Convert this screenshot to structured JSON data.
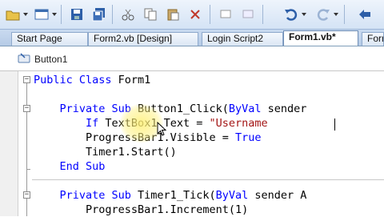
{
  "toolbar": {
    "icons": [
      "open-folder-icon",
      "layout-dropdown-icon",
      "save-icon",
      "save-all-icon",
      "cut-icon",
      "copy-icon",
      "paste-icon",
      "delete-icon",
      "undo-icon",
      "redo-icon",
      "navigate-icon"
    ]
  },
  "tabs": [
    {
      "label": "Start Page",
      "active": false
    },
    {
      "label": "Form2.vb [Design]",
      "active": false
    },
    {
      "label": "Login Script2",
      "active": false
    },
    {
      "label": "Form1.vb*",
      "active": true
    },
    {
      "label": "Form",
      "active": false
    }
  ],
  "object_combo": {
    "label": "Button1",
    "icon": "button-component-icon"
  },
  "code_lines": [
    {
      "tokens": [
        {
          "t": "Public Class ",
          "k": "kw"
        },
        {
          "t": "Form1",
          "k": ""
        }
      ]
    },
    {
      "tokens": []
    },
    {
      "tokens": [
        {
          "t": "    Private Sub ",
          "k": "kw"
        },
        {
          "t": "Button1_Click(",
          "k": ""
        },
        {
          "t": "ByVal",
          "k": "kw"
        },
        {
          "t": " sender",
          "k": ""
        }
      ]
    },
    {
      "tokens": [
        {
          "t": "        ",
          "k": ""
        },
        {
          "t": "If ",
          "k": "kw"
        },
        {
          "t": "TextBox1.Text = ",
          "k": ""
        },
        {
          "t": "\"Username",
          "k": "str"
        }
      ]
    },
    {
      "tokens": [
        {
          "t": "        ProgressBar1.Visible = ",
          "k": ""
        },
        {
          "t": "True",
          "k": "kw"
        }
      ]
    },
    {
      "tokens": [
        {
          "t": "        Timer1.Start()",
          "k": ""
        }
      ]
    },
    {
      "tokens": [
        {
          "t": "    End Sub",
          "k": "kw"
        }
      ]
    },
    {
      "tokens": []
    },
    {
      "tokens": [
        {
          "t": "    Private Sub ",
          "k": "kw"
        },
        {
          "t": "Timer1_Tick(",
          "k": ""
        },
        {
          "t": "ByVal",
          "k": "kw"
        },
        {
          "t": " sender A",
          "k": ""
        }
      ]
    },
    {
      "tokens": [
        {
          "t": "        ProgressBar1.Increment(1)",
          "k": ""
        }
      ]
    }
  ],
  "colors": {
    "keyword": "#0000ff",
    "string": "#a31515",
    "text": "#000000"
  }
}
